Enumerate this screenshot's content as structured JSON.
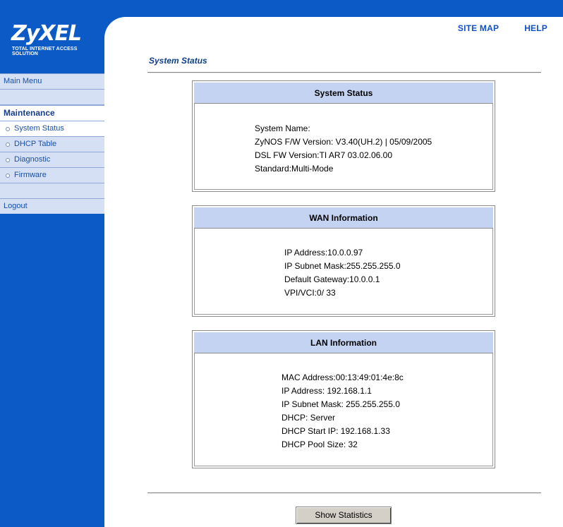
{
  "header": {
    "links": [
      "SITE MAP",
      "HELP"
    ],
    "logo": {
      "name": "ZyXEL",
      "tagline": "TOTAL INTERNET ACCESS SOLUTION"
    }
  },
  "sidebar": {
    "main_menu": "Main Menu",
    "section": "Maintenance",
    "items": [
      "System Status",
      "DHCP Table",
      "Diagnostic",
      "Firmware"
    ],
    "logout": "Logout"
  },
  "page": {
    "title": "System Status"
  },
  "system_status": {
    "title": "System Status",
    "lines": [
      "System Name:",
      "ZyNOS F/W Version: V3.40(UH.2) | 05/09/2005",
      "DSL FW Version:TI AR7 03.02.06.00",
      "Standard:Multi-Mode"
    ]
  },
  "wan": {
    "title": "WAN Information",
    "lines": [
      "IP Address:10.0.0.97",
      "IP Subnet Mask:255.255.255.0",
      "Default Gateway:10.0.0.1",
      "VPI/VCI:0/ 33"
    ]
  },
  "lan": {
    "title": "LAN Information",
    "lines": [
      "MAC Address:00:13:49:01:4e:8c",
      "IP Address: 192.168.1.1",
      "IP Subnet Mask: 255.255.255.0",
      "DHCP: Server",
      "DHCP Start IP: 192.168.1.33",
      "DHCP Pool Size: 32"
    ]
  },
  "actions": {
    "show_statistics": "Show Statistics"
  },
  "colors": {
    "brand_blue": "#0c5ac6",
    "panel_header": "#c5d3f3",
    "menu_row": "#d6e0f4"
  }
}
